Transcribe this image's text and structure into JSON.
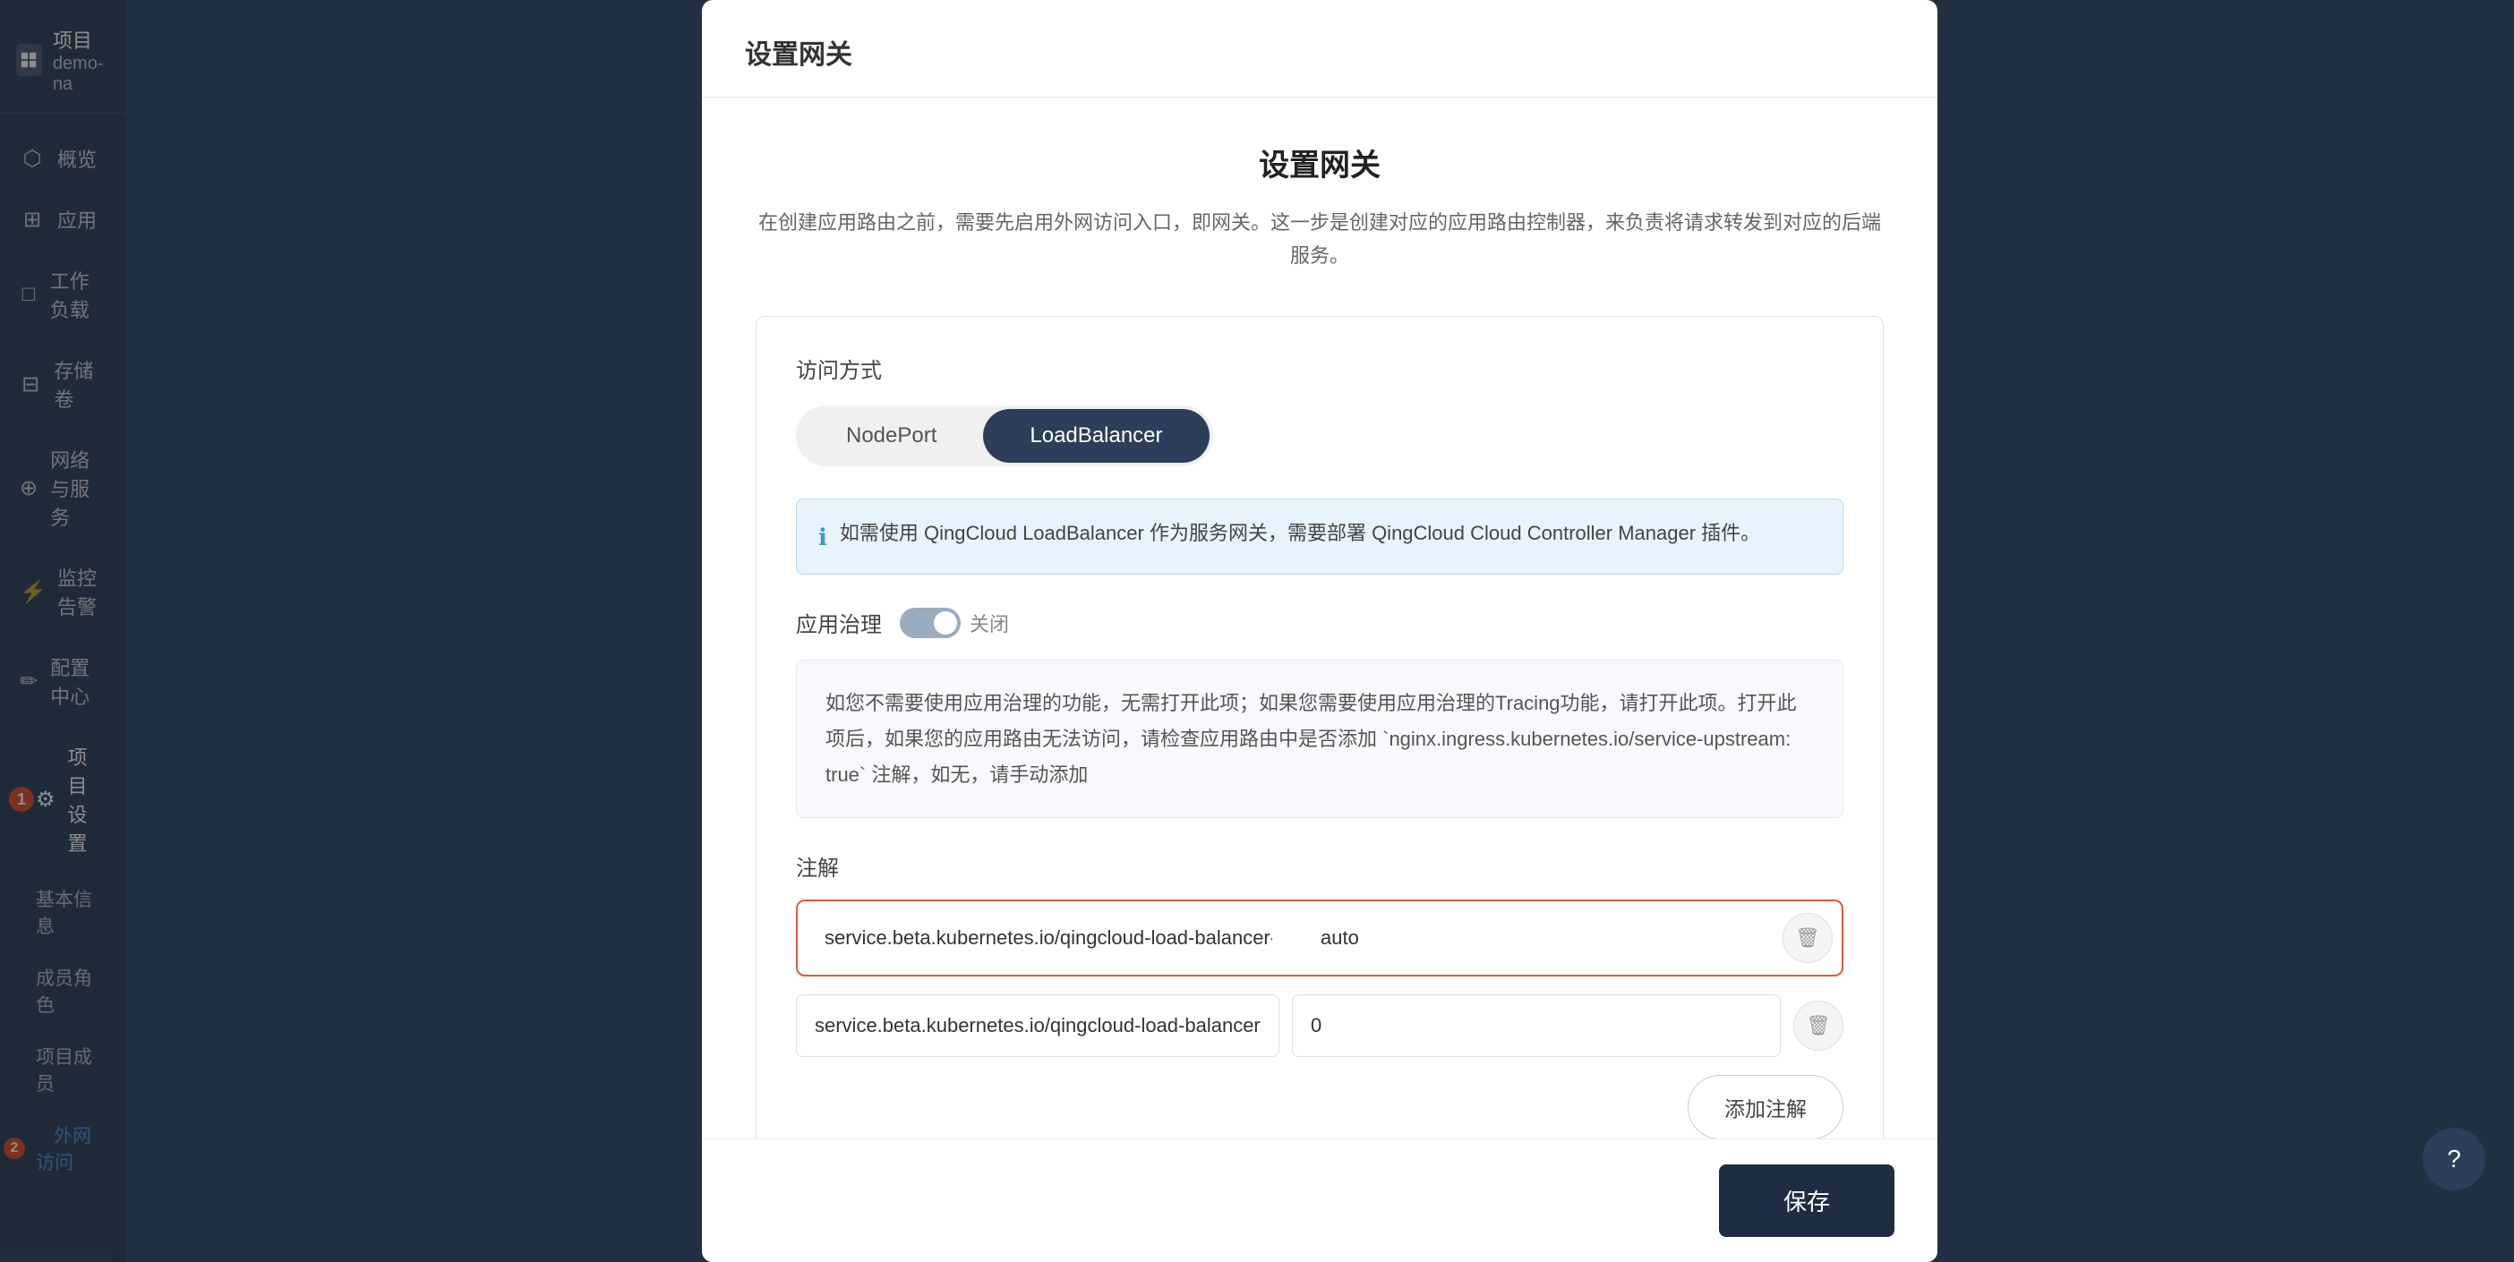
{
  "sidebar": {
    "project_label": "项目",
    "project_name": "demo-na",
    "nav_items": [
      {
        "id": "overview",
        "label": "概览",
        "icon": "⬡"
      },
      {
        "id": "apps",
        "label": "应用",
        "icon": "⊞"
      },
      {
        "id": "workloads",
        "label": "工作负载",
        "icon": "□"
      },
      {
        "id": "storage",
        "label": "存储卷",
        "icon": "⊟"
      },
      {
        "id": "network",
        "label": "网络与服务",
        "icon": "⊕"
      },
      {
        "id": "monitor",
        "label": "监控告警",
        "icon": "⚡"
      },
      {
        "id": "config",
        "label": "配置中心",
        "icon": "✏"
      },
      {
        "id": "project-settings",
        "label": "项目设置",
        "icon": "⚙",
        "badge": "1"
      }
    ],
    "sub_items": [
      {
        "id": "basic-info",
        "label": "基本信息"
      },
      {
        "id": "member-roles",
        "label": "成员角色"
      },
      {
        "id": "project-members",
        "label": "项目成员"
      },
      {
        "id": "external-access",
        "label": "外网访问",
        "active": true,
        "badge": "2"
      }
    ]
  },
  "dialog": {
    "title_bar": "设置网关",
    "main_title": "设置网关",
    "description": "在创建应用路由之前，需要先启用外网访问入口，即网关。这一步是创建对应的应用路由控制器，来负责将请求转发到对应的后端服务。",
    "access_method_label": "访问方式",
    "access_buttons": [
      {
        "id": "nodeport",
        "label": "NodePort",
        "active": false
      },
      {
        "id": "loadbalancer",
        "label": "LoadBalancer",
        "active": true
      }
    ],
    "info_banner": "如需使用 QingCloud LoadBalancer 作为服务网关，需要部署 QingCloud Cloud Controller Manager 插件。",
    "governance_label": "应用治理",
    "governance_toggle": "关闭",
    "governance_desc": "如您不需要使用应用治理的功能，无需打开此项；如果您需要使用应用治理的Tracing功能，请打开此项。打开此项后，如果您的应用路由无法访问，请检查应用路由中是否添加 `nginx.ingress.kubernetes.io/service-upstream: true` 注解，如无，请手动添加",
    "annotations_label": "注解",
    "annotations": [
      {
        "key": "service.beta.kubernetes.io/qingcloud-load-balancer-eip-source",
        "value": "auto",
        "highlighted": true
      },
      {
        "key": "service.beta.kubernetes.io/qingcloud-load-balancer-type",
        "value": "0",
        "highlighted": false
      }
    ],
    "add_annotation_label": "添加注解",
    "save_label": "保存"
  },
  "icons": {
    "info": "ℹ",
    "delete": "🗑",
    "dots": "⋮",
    "help": "?"
  }
}
